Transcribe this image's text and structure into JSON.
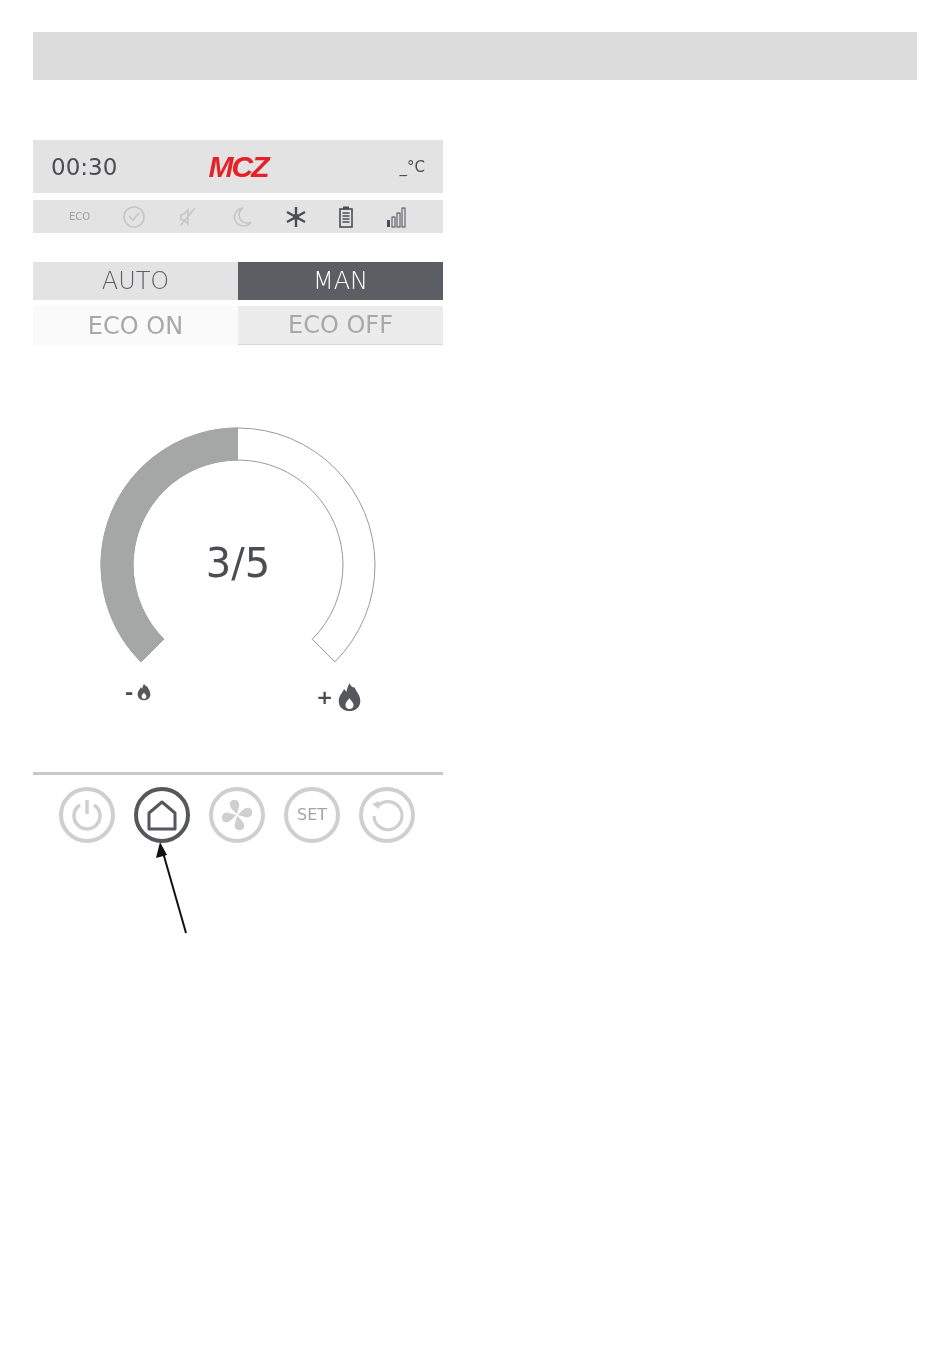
{
  "status_bar": {
    "time": "00:30",
    "logo": "MCZ",
    "temperature": "_°C"
  },
  "status_icons": [
    {
      "kind": "eco",
      "label": "ECO",
      "active": false
    },
    {
      "kind": "clock",
      "active": false
    },
    {
      "kind": "mute",
      "active": false
    },
    {
      "kind": "moon",
      "active": false
    },
    {
      "kind": "snowflake",
      "active": true
    },
    {
      "kind": "battery",
      "active": true
    },
    {
      "kind": "signal",
      "active": true
    }
  ],
  "mode_buttons": [
    {
      "label": "AUTO",
      "selected": false
    },
    {
      "label": "MAN",
      "selected": true
    }
  ],
  "eco_buttons": [
    {
      "label": "ECO ON",
      "selected": false,
      "disabled": true
    },
    {
      "label": "ECO OFF",
      "selected": true,
      "disabled": true
    }
  ],
  "power_dial": {
    "reading": "3/5",
    "minus_label": "-",
    "plus_label": "+"
  },
  "nav_buttons": [
    {
      "kind": "power",
      "selected": false
    },
    {
      "kind": "home",
      "selected": true
    },
    {
      "kind": "fan",
      "selected": false
    },
    {
      "kind": "set",
      "label": "SET",
      "selected": false
    },
    {
      "kind": "reset",
      "selected": false
    }
  ]
}
